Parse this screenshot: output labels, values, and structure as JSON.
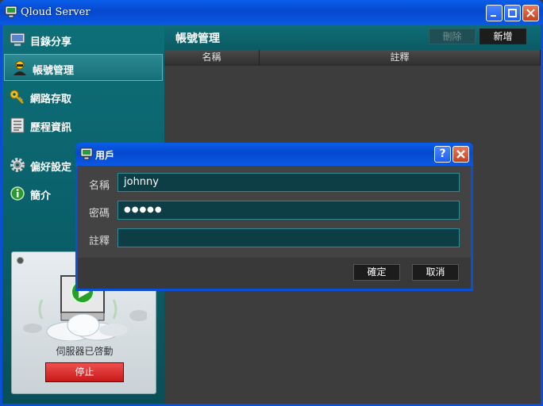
{
  "window": {
    "title": "Qloud Server"
  },
  "sidebar": {
    "items": [
      {
        "label": "目錄分享",
        "icon": "monitor-icon"
      },
      {
        "label": "帳號管理",
        "icon": "user-icon"
      },
      {
        "label": "網路存取",
        "icon": "key-icon"
      },
      {
        "label": "歷程資訊",
        "icon": "log-icon"
      },
      {
        "label": "偏好設定",
        "icon": "gear-icon"
      },
      {
        "label": "簡介",
        "icon": "info-icon"
      }
    ],
    "status": {
      "text": "伺服器已啓動",
      "stop_label": "停止"
    }
  },
  "main": {
    "title": "帳號管理",
    "delete_label": "刪除",
    "new_label": "新增",
    "columns": [
      "名稱",
      "註釋"
    ]
  },
  "dialog": {
    "title": "用戶",
    "help_label": "?",
    "fields": [
      {
        "label": "名稱",
        "value": "johnny"
      },
      {
        "label": "密碼",
        "value": "●●●●●"
      },
      {
        "label": "註釋",
        "value": ""
      }
    ],
    "ok_label": "確定",
    "cancel_label": "取消"
  },
  "colors": {
    "teal": "#0b5a63",
    "xp_blue": "#0b4fd6",
    "stop_red": "#d42020"
  }
}
